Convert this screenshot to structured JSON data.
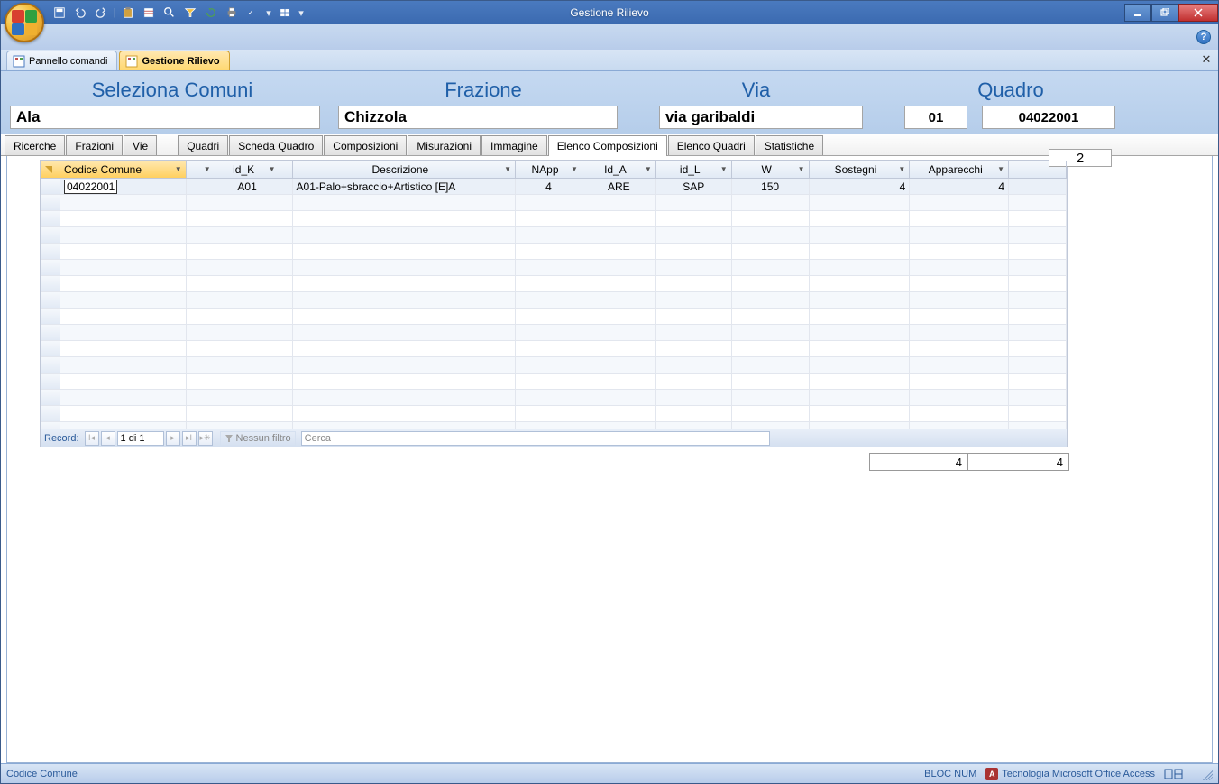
{
  "window": {
    "title": "Gestione Rilievo"
  },
  "doc_tabs": {
    "t1": "Pannello comandi",
    "t2": "Gestione Rilievo"
  },
  "form": {
    "headers": {
      "comuni": "Seleziona Comuni",
      "frazione": "Frazione",
      "via": "Via",
      "quadro": "Quadro"
    },
    "values": {
      "comuni": "Ala",
      "frazione": "Chizzola",
      "via": "via garibaldi",
      "q1": "01",
      "q2": "04022001",
      "q3": "2"
    }
  },
  "inner_tabs": {
    "t0": "Ricerche",
    "t1": "Frazioni",
    "t2": "Vie",
    "t3": "Quadri",
    "t4": "Scheda Quadro",
    "t5": "Composizioni",
    "t6": "Misurazioni",
    "t7": "Immagine",
    "t8": "Elenco Composizioni",
    "t9": "Elenco Quadri",
    "t10": "Statistiche"
  },
  "grid": {
    "headers": {
      "c1": "Codice Comune",
      "c3": "id_K",
      "c5": "Descrizione",
      "c6": "NApp",
      "c7": "Id_A",
      "c8": "id_L",
      "c9": "W",
      "c10": "Sostegni",
      "c11": "Apparecchi"
    },
    "rows": [
      {
        "c1": "04022001",
        "c3": "A01",
        "c5": "A01-Palo+sbraccio+Artistico [E]A",
        "c6": "4",
        "c7": "ARE",
        "c8": "SAP",
        "c9": "150",
        "c10": "4",
        "c11": "4"
      }
    ]
  },
  "recnav": {
    "label": "Record:",
    "pos": "1 di 1",
    "filter": "Nessun filtro",
    "search": "Cerca"
  },
  "totals": {
    "sostegni": "4",
    "apparecchi": "4"
  },
  "status": {
    "left": "Codice Comune",
    "numlock": "BLOC NUM",
    "tech": "Tecnologia Microsoft Office Access"
  }
}
